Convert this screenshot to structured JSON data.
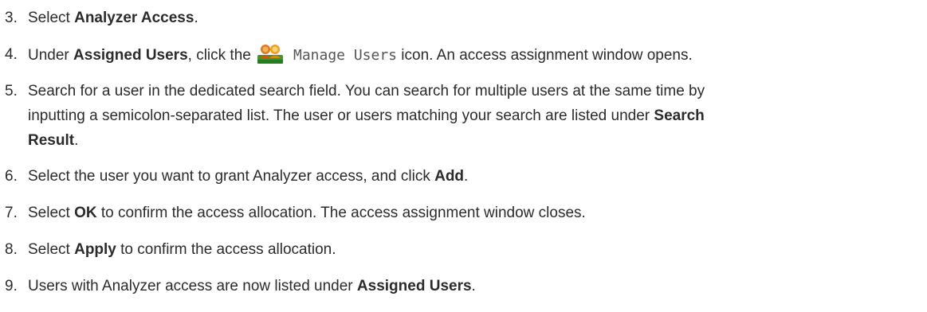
{
  "steps": [
    {
      "num": "3.",
      "pre": "Select ",
      "bold": "Analyzer Access",
      "post": "."
    },
    {
      "num": "4.",
      "pre": "Under ",
      "bold": "Assigned Users",
      "mid": ", click the ",
      "icon": "manage-users-icon",
      "code": " Manage Users",
      "post": " icon. An access assignment window opens."
    },
    {
      "num": "5.",
      "line1": "Search for a user in the dedicated search field. You can search for multiple users at the same time by",
      "line2_pre": "inputting a semicolon-separated list. The user or users matching your search are listed under ",
      "line2_bold": "Search",
      "line3_bold": "Result",
      "line3_post": "."
    },
    {
      "num": "6.",
      "pre": "Select the user you want to grant Analyzer access, and click ",
      "bold": "Add",
      "post": "."
    },
    {
      "num": "7.",
      "pre": "Select ",
      "bold": "OK",
      "post": " to confirm the access allocation. The access assignment window closes."
    },
    {
      "num": "8.",
      "pre": "Select ",
      "bold": "Apply",
      "post": " to confirm the access allocation."
    },
    {
      "num": "9.",
      "pre": "Users with Analyzer access are now listed under ",
      "bold": "Assigned Users",
      "post": "."
    }
  ]
}
